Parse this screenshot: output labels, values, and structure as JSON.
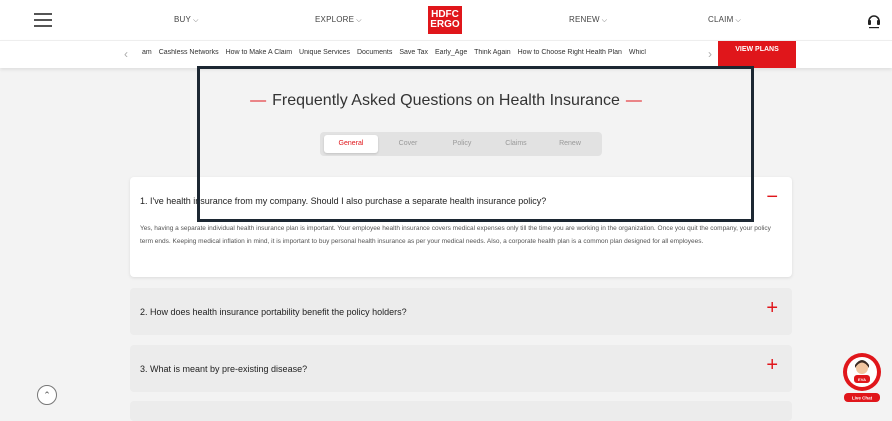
{
  "header": {
    "nav": [
      {
        "label": "BUY"
      },
      {
        "label": "EXPLORE"
      },
      {
        "label": "RENEW"
      },
      {
        "label": "CLAIM"
      }
    ],
    "logo_lines": [
      "HDFC",
      "ERGO"
    ]
  },
  "subnav": {
    "links": [
      "am",
      "Cashless Networks",
      "How to Make A Claim",
      "Unique Services",
      "Documents",
      "Save Tax",
      "Early_Age",
      "Think Again",
      "How to Choose Right Health Plan",
      "Whicl"
    ],
    "view_plans": "VIEW PLANS"
  },
  "faq": {
    "title": "Frequently Asked Questions on Health Insurance",
    "tabs": [
      "General",
      "Cover",
      "Policy",
      "Claims",
      "Renew"
    ],
    "active_tab": "General",
    "items": [
      {
        "question": "1. I've health insurance from my company. Should I also purchase a separate health insurance policy?",
        "answer": "Yes, having a separate individual health insurance plan is important. Your employee health insurance covers medical expenses only till the time you are working in the organization. Once you quit the company, your policy term ends. Keeping medical inflation in mind, it is important to buy personal health insurance as per your medical needs. Also, a corporate health plan is a common plan designed for all employees.",
        "toggle": "−"
      },
      {
        "question": "2. How does health insurance portability benefit the policy holders?",
        "toggle": "+"
      },
      {
        "question": "3. What is meant by pre-existing disease?",
        "toggle": "+"
      }
    ]
  },
  "chat": {
    "badge": "EVA",
    "label": "Live Chat"
  },
  "colors": {
    "brand_red": "#e0161b",
    "highlight_border": "#1c2732"
  }
}
